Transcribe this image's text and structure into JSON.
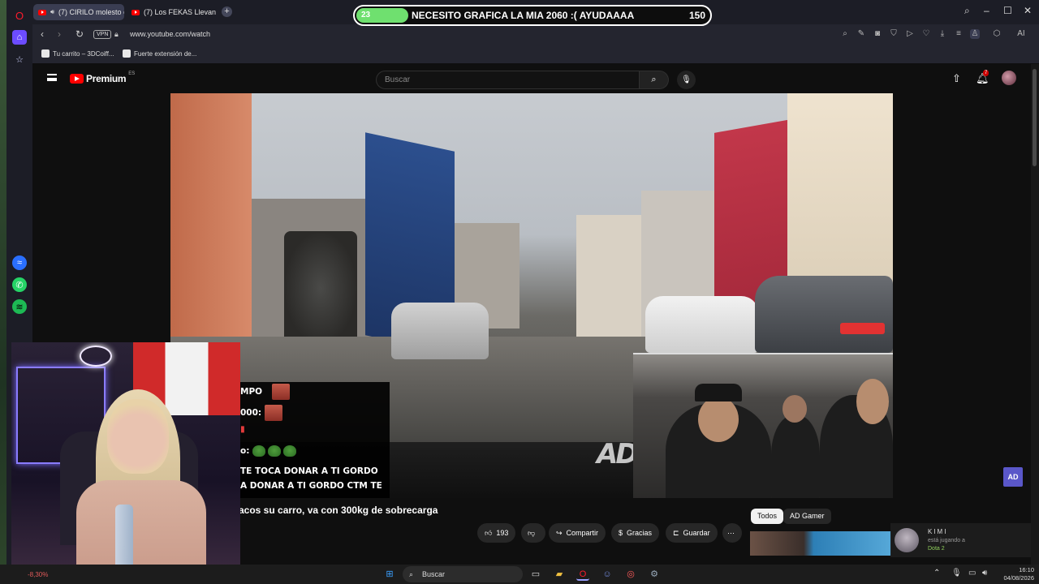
{
  "browser": {
    "tabs": [
      {
        "label": "(7) CIRILO molesto co",
        "active": true
      },
      {
        "label": "(7) Los FEKAS Llevan com",
        "active": false
      }
    ],
    "vpn_label": "VPN",
    "url": "www.youtube.com/watch",
    "bookmarks": [
      {
        "label": "Tu carrito – 3DCoiff..."
      },
      {
        "label": "Fuerte extensión de..."
      }
    ],
    "ai_label": "AI"
  },
  "youtube": {
    "logo_text": "Premium",
    "region": "ES",
    "search_placeholder": "Buscar",
    "notification_count": "7",
    "video_title": "acos su carro, va con 300kg de sobrecarga",
    "watermark": "AD",
    "like_count": "193",
    "actions": {
      "share": "Compartir",
      "thanks": "Gracias",
      "save": "Guardar",
      "more": "⋯"
    },
    "chips": [
      "Todos",
      "AD Gamer"
    ],
    "channel_badge": "AD"
  },
  "chat_overlay": {
    "lines": [
      "MPO",
      "000:",
      "o:",
      "TE TOCA DONAR A TI GORDO",
      "A DONAR A TI GORDO CTM TE"
    ]
  },
  "donation_bar": {
    "progress_value": "23",
    "message": "NECESITO GRAFICA LA MIA 2060 :( AYUDAAAA",
    "goal": "150",
    "accent": "#6fe06f"
  },
  "friend_activity": {
    "name": "KIMI",
    "status": "está jugando a",
    "game": "Dota 2"
  },
  "taskbar": {
    "stat": "-8,30%",
    "search_label": "Buscar",
    "time": "16:10",
    "date": "04/08/2026"
  },
  "colors": {
    "youtube_red": "#ff0000",
    "opera_red": "#ff1b2d",
    "dark_bg": "#0f0f0f"
  }
}
